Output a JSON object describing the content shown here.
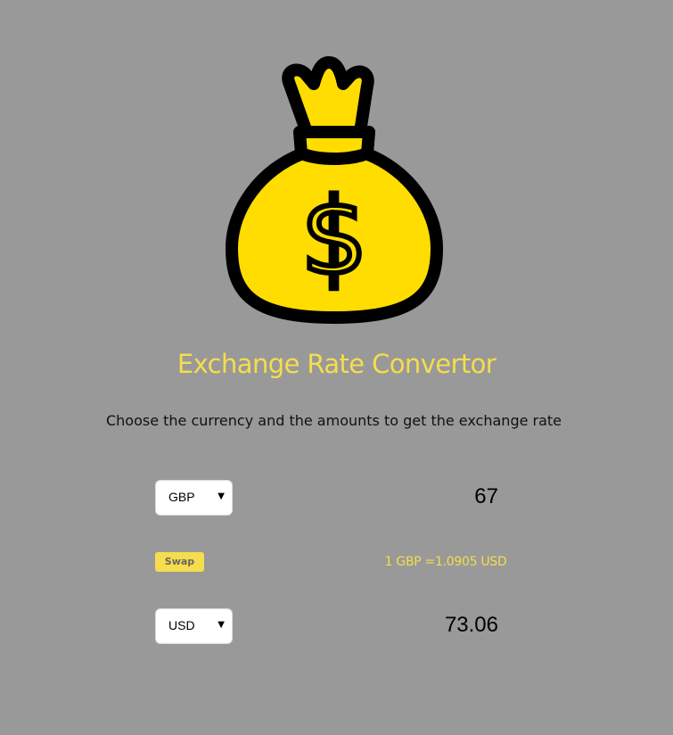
{
  "header": {
    "logo_icon": "money-bag-dollar-icon",
    "title": "Exchange Rate Convertor",
    "subtitle": "Choose the currency and the amounts to get the exchange rate"
  },
  "colors": {
    "background": "#999999",
    "accent": "#f5dd4d",
    "bag_fill": "#ffdd00"
  },
  "converter": {
    "from": {
      "currency": "GBP",
      "amount": "67"
    },
    "swap_label": "Swap",
    "rate_text": "1 GBP =1.0905 USD",
    "to": {
      "currency": "USD",
      "amount": "73.06"
    }
  }
}
